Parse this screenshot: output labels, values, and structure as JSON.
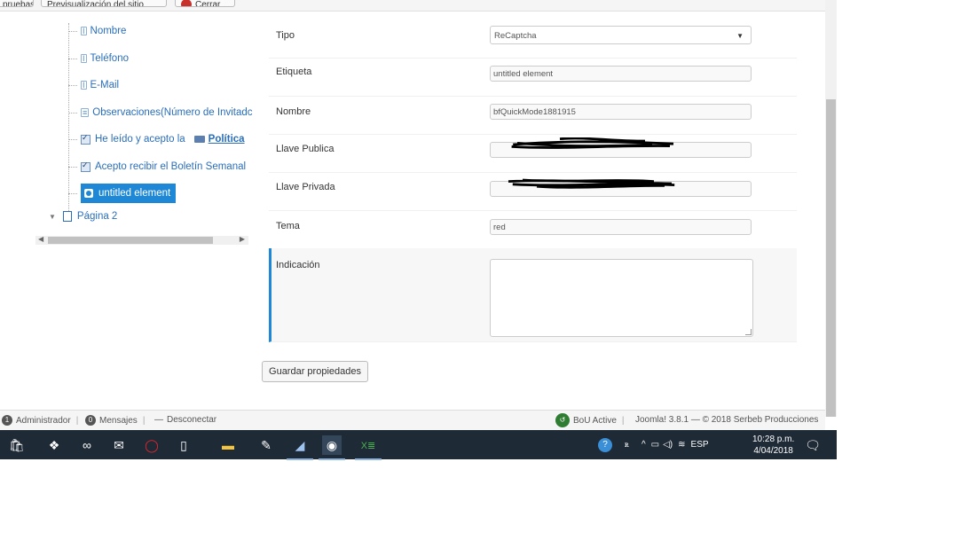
{
  "toolbar": {
    "buttons": [
      "pruebas",
      "Previsualización del sitio",
      "Cerrar"
    ]
  },
  "tree": {
    "items": [
      {
        "label": "Nombre",
        "kind": "text"
      },
      {
        "label": "Teléfono",
        "kind": "text"
      },
      {
        "label": "E-Mail",
        "kind": "text"
      },
      {
        "label": "Observaciones(Número de Invitadc",
        "kind": "textarea"
      },
      {
        "label": "He leído y acepto la",
        "link": "Política",
        "kind": "checkbox"
      },
      {
        "label": "Acepto recibir el Boletín Semanal",
        "kind": "checkbox"
      }
    ],
    "selected": "untitled element",
    "page2": "Página 2"
  },
  "form": {
    "tipo": {
      "label": "Tipo",
      "value": "ReCaptcha"
    },
    "etiqueta": {
      "label": "Etiqueta",
      "value": "untitled element"
    },
    "nombre": {
      "label": "Nombre",
      "value": "bfQuickMode1881915"
    },
    "llave_publica": {
      "label": "Llave Publica",
      "value": ""
    },
    "llave_privada": {
      "label": "Llave Privada",
      "value": ""
    },
    "tema": {
      "label": "Tema",
      "value": "red"
    },
    "indicacion": {
      "label": "Indicación",
      "value": ""
    },
    "save_label": "Guardar propiedades"
  },
  "status": {
    "admin_count": "1",
    "admin_label": "Administrador",
    "messages_count": "0",
    "messages_label": "Mensajes",
    "logout_label": "Desconectar",
    "bou_label": "BoU Active",
    "footer": "Joomla! 3.8.1 — © 2018 Serbeb Producciones"
  },
  "taskbar": {
    "lang": "ESP",
    "time": "10:28 p.m.",
    "date": "4/04/2018",
    "apps": [
      "store-icon",
      "dropbox-icon",
      "infinity-icon",
      "mail-icon",
      "opera-icon",
      "file-icon",
      "explorer-icon",
      "paint-icon",
      "media-icon",
      "chrome-icon",
      "excel-icon"
    ]
  }
}
